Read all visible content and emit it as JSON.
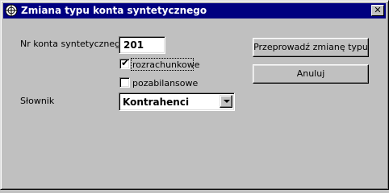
{
  "window": {
    "title": "Zmiana typu konta syntetycznego",
    "close_label": "✕"
  },
  "form": {
    "account_label": "Nr konta syntetycznego",
    "account_value": "201",
    "checkbox1_label": "rozrachunkowe",
    "checkbox1_checked": true,
    "checkbox2_label": "pozabilansowe",
    "checkbox2_checked": false,
    "dictionary_label": "Słownik",
    "dictionary_value": "Kontrahenci"
  },
  "buttons": {
    "apply_label": "Przeprowadź zmianę typu",
    "cancel_label": "Anuluj"
  },
  "colors": {
    "titlebar": "#000080",
    "face": "#c0c0c0"
  },
  "icons": {
    "app": "app-icon",
    "check": "checkmark-icon",
    "dropdown": "chevron-down-icon",
    "close": "close-icon"
  }
}
